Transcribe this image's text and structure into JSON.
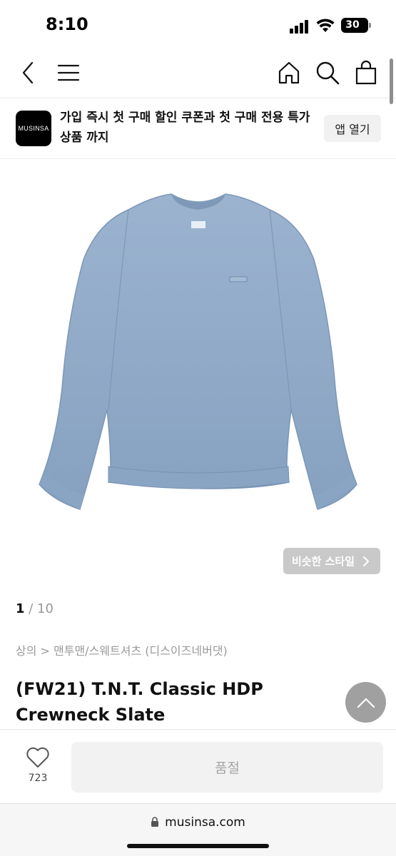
{
  "status_bar": {
    "time": "8:10",
    "battery_level": "30",
    "icons": [
      "signal-icon",
      "wifi-icon",
      "battery-icon"
    ]
  },
  "nav": {
    "icons": [
      "back-arrow-icon",
      "menu-icon",
      "home-icon",
      "search-icon",
      "shopping-bag-icon"
    ]
  },
  "app_banner": {
    "logo_text": "MUSINSA",
    "message": "가입 즉시 첫 구매 할인 쿠폰과 첫 구매 전용 특가 상품 까지",
    "open_app_label": "앱 열기"
  },
  "product_image": {
    "similar_style_label": "비슷한 스타일",
    "garment_color": "#93acc9",
    "garment_name": "crewneck-sweatshirt"
  },
  "pagination": {
    "current": "1",
    "separator": " / ",
    "total": "10"
  },
  "product": {
    "breadcrumb": "상의 > 맨투맨/스웨트셔츠 (디스이즈네버댓)",
    "title": "(FW21) T.N.T. Classic HDP Crewneck Slate"
  },
  "bottom_bar": {
    "like_count": "723",
    "sold_out_label": "품절"
  },
  "url_bar": {
    "domain": "musinsa.com"
  },
  "colors": {
    "sold_out_bg": "#f2f2f2",
    "similar_style_bg": "#c9c9c9",
    "scroll_top_bg": "#a0a0a0"
  }
}
